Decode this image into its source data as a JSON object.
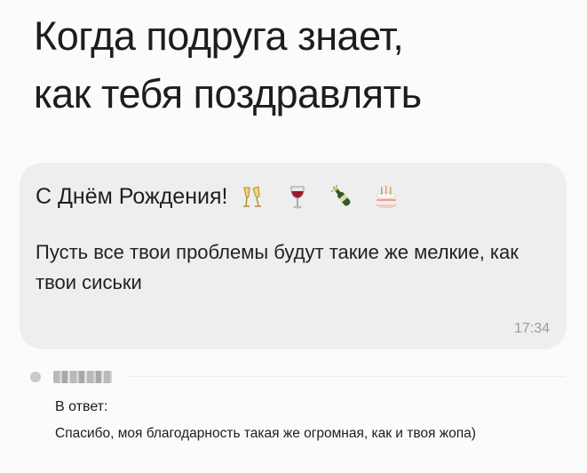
{
  "caption": {
    "line1": "Когда подруга знает,",
    "line2": "как тебя поздравлять"
  },
  "message": {
    "greeting": "С Днём Рождения!",
    "emojis": [
      "clinking-glasses-icon",
      "wine-glass-icon",
      "champagne-bottle-icon",
      "birthday-cake-icon"
    ],
    "body": "Пусть все твои проблемы будут такие же мелкие, как твои сиськи",
    "time": "17:34"
  },
  "reply": {
    "label": "В ответ:",
    "text": "Спасибо, моя благодарность такая же огромная, как и твоя жопа)"
  },
  "colors": {
    "bubble": "#eeeeee",
    "background": "#fbfbfb",
    "time": "#9c9c9c"
  }
}
